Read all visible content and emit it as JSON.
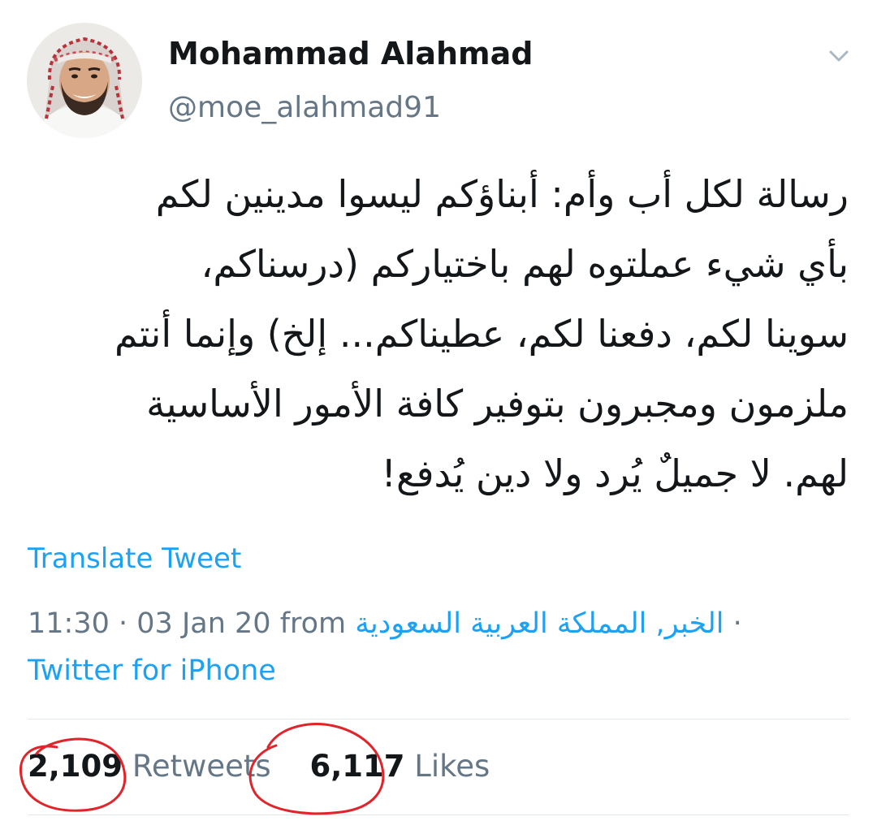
{
  "user": {
    "display_name": "Mohammad Alahmad",
    "handle": "@moe_alahmad91",
    "avatar_icon": "profile-photo"
  },
  "menu": {
    "caret_icon": "chevron-down-icon"
  },
  "tweet": {
    "lines": [
      "رسالة لكل أب وأم: أبناؤكم ليسوا مدينين لكم",
      "بأي شيء عملتوه لهم باختياركم (درسناكم،",
      "سوينا لكم، دفعنا لكم، عطيناكم... إلخ) وإنما أنتم",
      "ملزمون ومجبرون بتوفير كافة الأمور الأساسية",
      "لهم. لا جميلٌ يُرد ولا دين يُدفع!"
    ]
  },
  "translate_label": "Translate Tweet",
  "meta": {
    "time": "11:30",
    "date": "03 Jan 20",
    "from_label": "from",
    "location": "الخبر, المملكة العربية السعودية",
    "source": "Twitter for iPhone"
  },
  "stats": {
    "retweets_count": "2,109",
    "retweets_label": "Retweets",
    "likes_count": "6,117",
    "likes_label": "Likes"
  },
  "colors": {
    "link": "#1da1f2",
    "secondary_text": "#657786",
    "primary_text": "#14171a",
    "annotation": "#e0242a"
  }
}
